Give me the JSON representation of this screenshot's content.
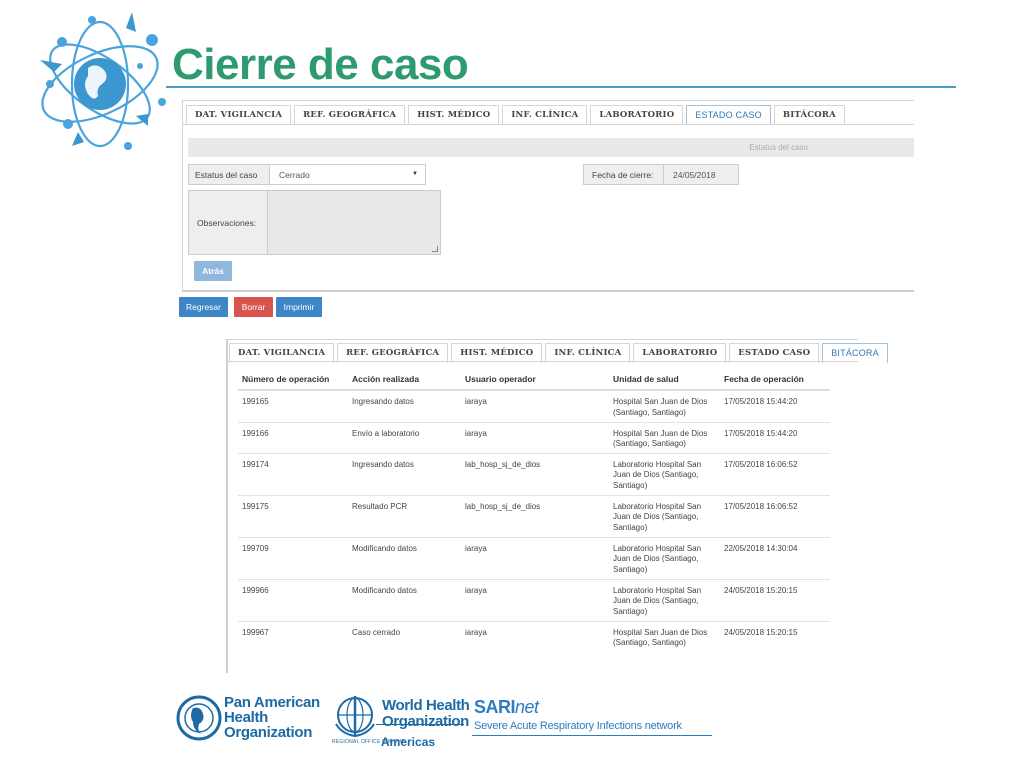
{
  "slide": {
    "title": "Cierre de caso"
  },
  "tabs": [
    "DAT. VIGILANCIA",
    "REF. GEOGRÁFICA",
    "HIST. MÉDICO",
    "INF. CLÍNICA",
    "LABORATORIO",
    "ESTADO CASO",
    "BITÁCORA"
  ],
  "estado": {
    "active_tab_index": 5,
    "section_header": "Estatus del caso",
    "status_label": "Estatus del caso",
    "status_value": "Cerrado",
    "close_date_label": "Fecha de cierre:",
    "close_date_value": "24/05/2018",
    "observations_label": "Observaciones:",
    "observations_value": "",
    "back_button": "Atrás"
  },
  "actions": {
    "regresar": "Regresar",
    "borrar": "Borrar",
    "imprimir": "Imprimir"
  },
  "colors": {
    "title_green": "#2d9b6f",
    "primary_blue": "#3f86c6",
    "danger_red": "#d9534f",
    "rule_blue": "#4a9ccf"
  },
  "bitacora": {
    "active_tab_index": 6,
    "columns": [
      "Número de operación",
      "Acción realizada",
      "Usuario operador",
      "Unidad de salud",
      "Fecha de operación"
    ],
    "rows": [
      {
        "num": "199165",
        "accion": "Ingresando datos",
        "usuario": "iaraya",
        "unidad": "Hospital San Juan de Dios (Santiago, Santiago)",
        "fecha": "17/05/2018 15:44:20"
      },
      {
        "num": "199166",
        "accion": "Envío a laboratorio",
        "usuario": "iaraya",
        "unidad": "Hospital San Juan de Dios (Santiago, Santiago)",
        "fecha": "17/05/2018 15:44:20"
      },
      {
        "num": "199174",
        "accion": "Ingresando datos",
        "usuario": "lab_hosp_sj_de_dios",
        "unidad": "Laboratorio Hospital San Juan de Dios (Santiago, Santiago)",
        "fecha": "17/05/2018 16:06:52"
      },
      {
        "num": "199175",
        "accion": "Resultado PCR",
        "usuario": "lab_hosp_sj_de_dios",
        "unidad": "Laboratorio Hospital San Juan de Dios (Santiago, Santiago)",
        "fecha": "17/05/2018 16:06:52"
      },
      {
        "num": "199709",
        "accion": "Modificando datos",
        "usuario": "iaraya",
        "unidad": "Laboratorio Hospital San Juan de Dios (Santiago, Santiago)",
        "fecha": "22/05/2018 14:30:04"
      },
      {
        "num": "199966",
        "accion": "Modificando datos",
        "usuario": "iaraya",
        "unidad": "Laboratorio Hospital San Juan de Dios (Santiago, Santiago)",
        "fecha": "24/05/2018 15:20:15"
      },
      {
        "num": "199967",
        "accion": "Caso cerrado",
        "usuario": "iaraya",
        "unidad": "Hospital San Juan de Dios (Santiago, Santiago)",
        "fecha": "24/05/2018 15:20:15"
      }
    ]
  },
  "footer": {
    "paho_line1": "Pan American",
    "paho_line2": "Health",
    "paho_line3": "Organization",
    "who_line1": "World Health",
    "who_line2": "Organization",
    "who_regional": "REGIONAL OFFICE FOR THE",
    "who_americas": "Americas",
    "sari_title": "SARI",
    "sari_title_suffix": "net",
    "sari_subtitle": "Severe Acute Respiratory Infections network"
  }
}
